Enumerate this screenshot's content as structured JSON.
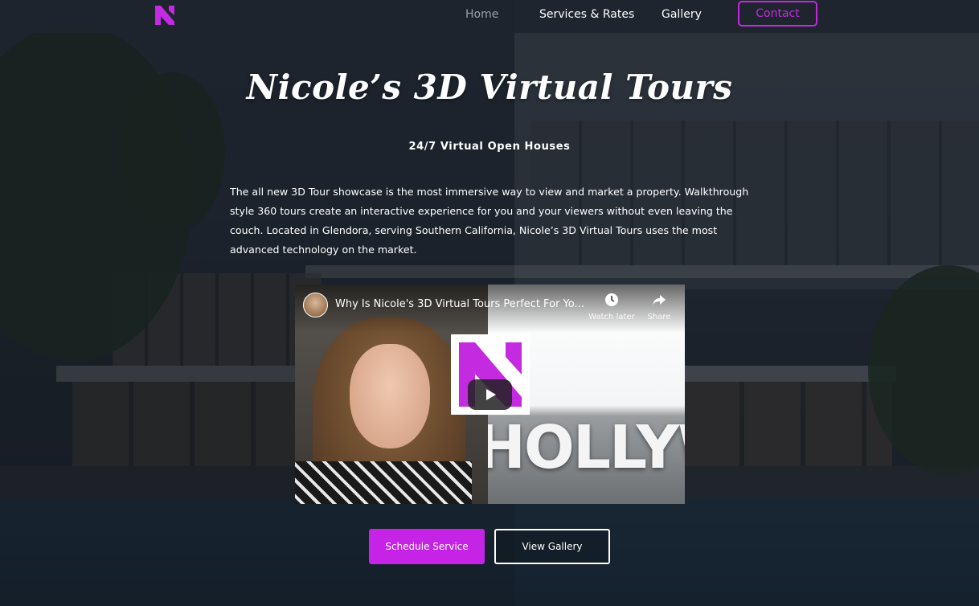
{
  "brand": {
    "accent": "#c42ae0",
    "logo_icon": "n-logo-icon"
  },
  "nav": {
    "items": [
      {
        "label": "Home",
        "active": true
      },
      {
        "label": "Services & Rates",
        "active": false
      },
      {
        "label": "Gallery",
        "active": false
      }
    ],
    "contact_label": "Contact"
  },
  "hero": {
    "title": "Nicole’s 3D Virtual Tours",
    "subtitle": "24/7 Virtual Open Houses",
    "description": "The all new 3D Tour showcase is the most immersive way to view and market a property. Walkthrough style 360 tours create an interactive experience for you and your viewers without even leaving the couch. Located in Glendora, serving Southern California, Nicole’s 3D Virtual Tours uses the most advanced technology on the market."
  },
  "video": {
    "title": "Why Is Nicole's 3D Virtual Tours Perfect For Yo...",
    "watch_later_label": "Watch later",
    "share_label": "Share",
    "thumbnail_text": "HOLLYWO",
    "play_icon": "play-icon"
  },
  "cta": {
    "primary_label": "Schedule Service",
    "secondary_label": "View Gallery"
  }
}
